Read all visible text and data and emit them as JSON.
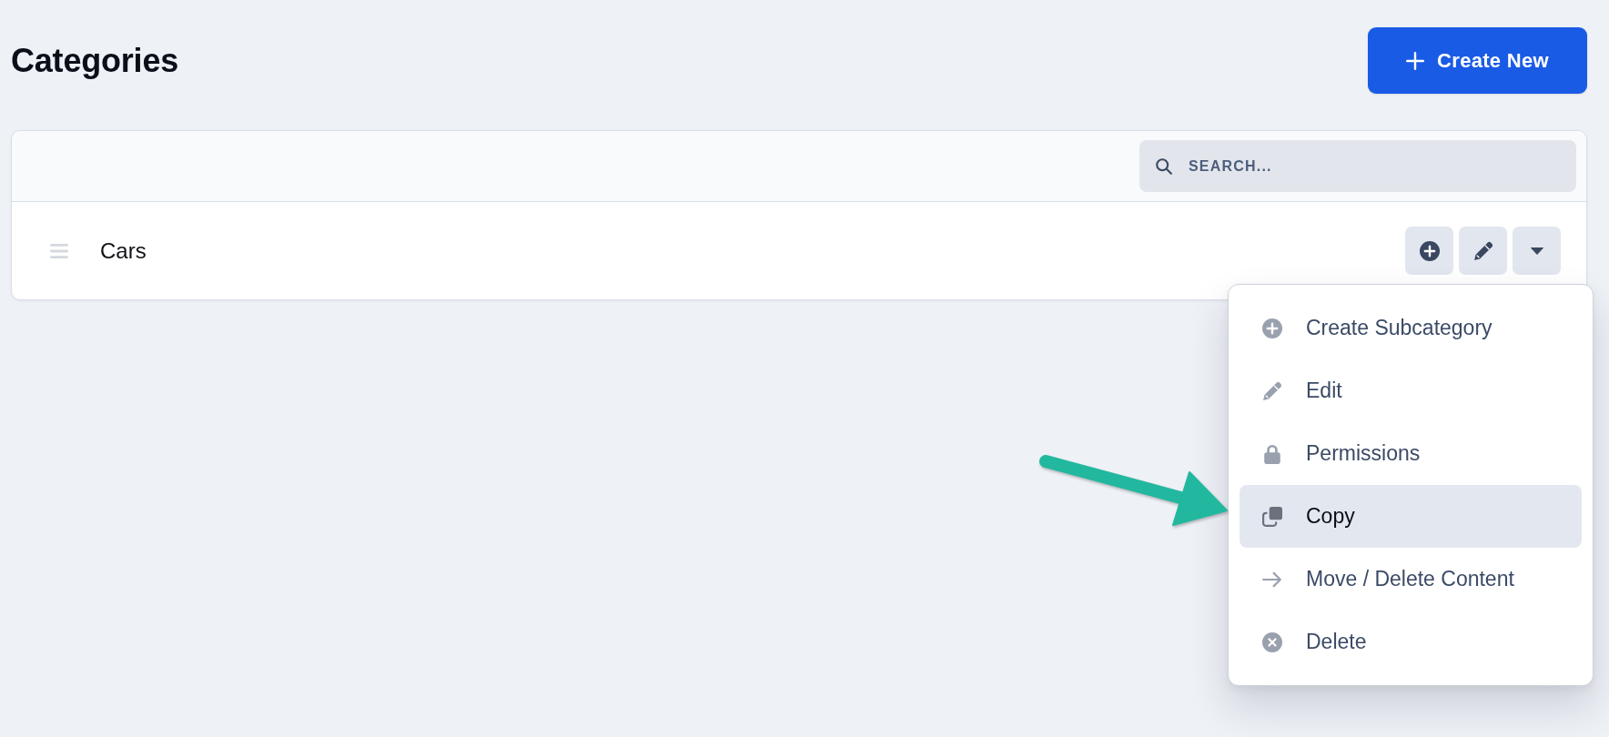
{
  "page": {
    "title": "Categories"
  },
  "create_button": {
    "label": "Create New"
  },
  "search": {
    "placeholder": "SEARCH..."
  },
  "rows": [
    {
      "name": "Cars",
      "menu": [
        {
          "label": "Create Subcategory",
          "selected": false
        },
        {
          "label": "Edit",
          "selected": false
        },
        {
          "label": "Permissions",
          "selected": false
        },
        {
          "label": "Copy",
          "selected": true
        },
        {
          "label": "Move / Delete Content",
          "selected": false
        },
        {
          "label": "Delete",
          "selected": false
        }
      ]
    }
  ]
}
